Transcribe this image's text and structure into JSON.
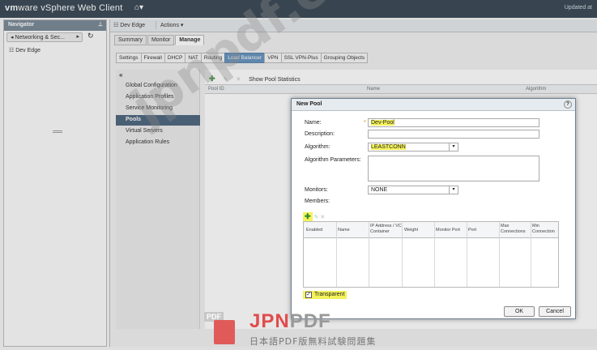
{
  "app": {
    "logo_brand": "vm",
    "logo_text": "ware",
    "logo_product": "vSphere Web Client",
    "home_icon": "home-icon",
    "updated_text": "Updated at"
  },
  "navigator": {
    "title": "Navigator",
    "breadcrumb": "Networking & Sec...",
    "tree_item": "Dev Edge"
  },
  "header": {
    "object": "Dev Edge",
    "actions": "Actions ▾"
  },
  "tabs": [
    "Summary",
    "Monitor",
    "Manage"
  ],
  "active_tab": "Manage",
  "subtabs": [
    "Settings",
    "Firewall",
    "DHCP",
    "NAT",
    "Routing",
    "Load Balancer",
    "VPN",
    "SSL VPN-Plus",
    "Grouping Objects"
  ],
  "active_subtab": "Load Balancer",
  "left_menu": {
    "collapse": "«",
    "items": [
      "Global Configuration",
      "Application Profiles",
      "Service Monitoring",
      "Pools",
      "Virtual Servers",
      "Application Rules"
    ],
    "active": "Pools"
  },
  "toolbar": {
    "show_stats": "Show Pool Statistics"
  },
  "grid": {
    "columns": [
      "Pool ID",
      "Name",
      "Algorithm"
    ]
  },
  "dialog": {
    "title": "New Pool",
    "name_label": "Name:",
    "name_value": "Dev-Pool",
    "description_label": "Description:",
    "algorithm_label": "Algorithm:",
    "algorithm_value": "LEASTCONN",
    "algorithm_params_label": "Algorithm Parameters:",
    "monitors_label": "Monitors:",
    "monitors_value": "NONE",
    "members_label": "Members:",
    "member_columns": [
      "Enabled",
      "Name",
      "IP Address / VC Container",
      "Weight",
      "Monitor Port",
      "Port",
      "Max Connections",
      "Min Connection"
    ],
    "transparent_label": "Transparent",
    "transparent_checked": true,
    "ok_label": "OK",
    "cancel_label": "Cancel"
  },
  "watermark": {
    "diagonal": "jpnpdf.com",
    "brand_tag": "PDF",
    "brand_jpn": "JPN",
    "brand_pdf": "PDF",
    "brand_sub": "日本語PDF版無料試験問題集"
  }
}
